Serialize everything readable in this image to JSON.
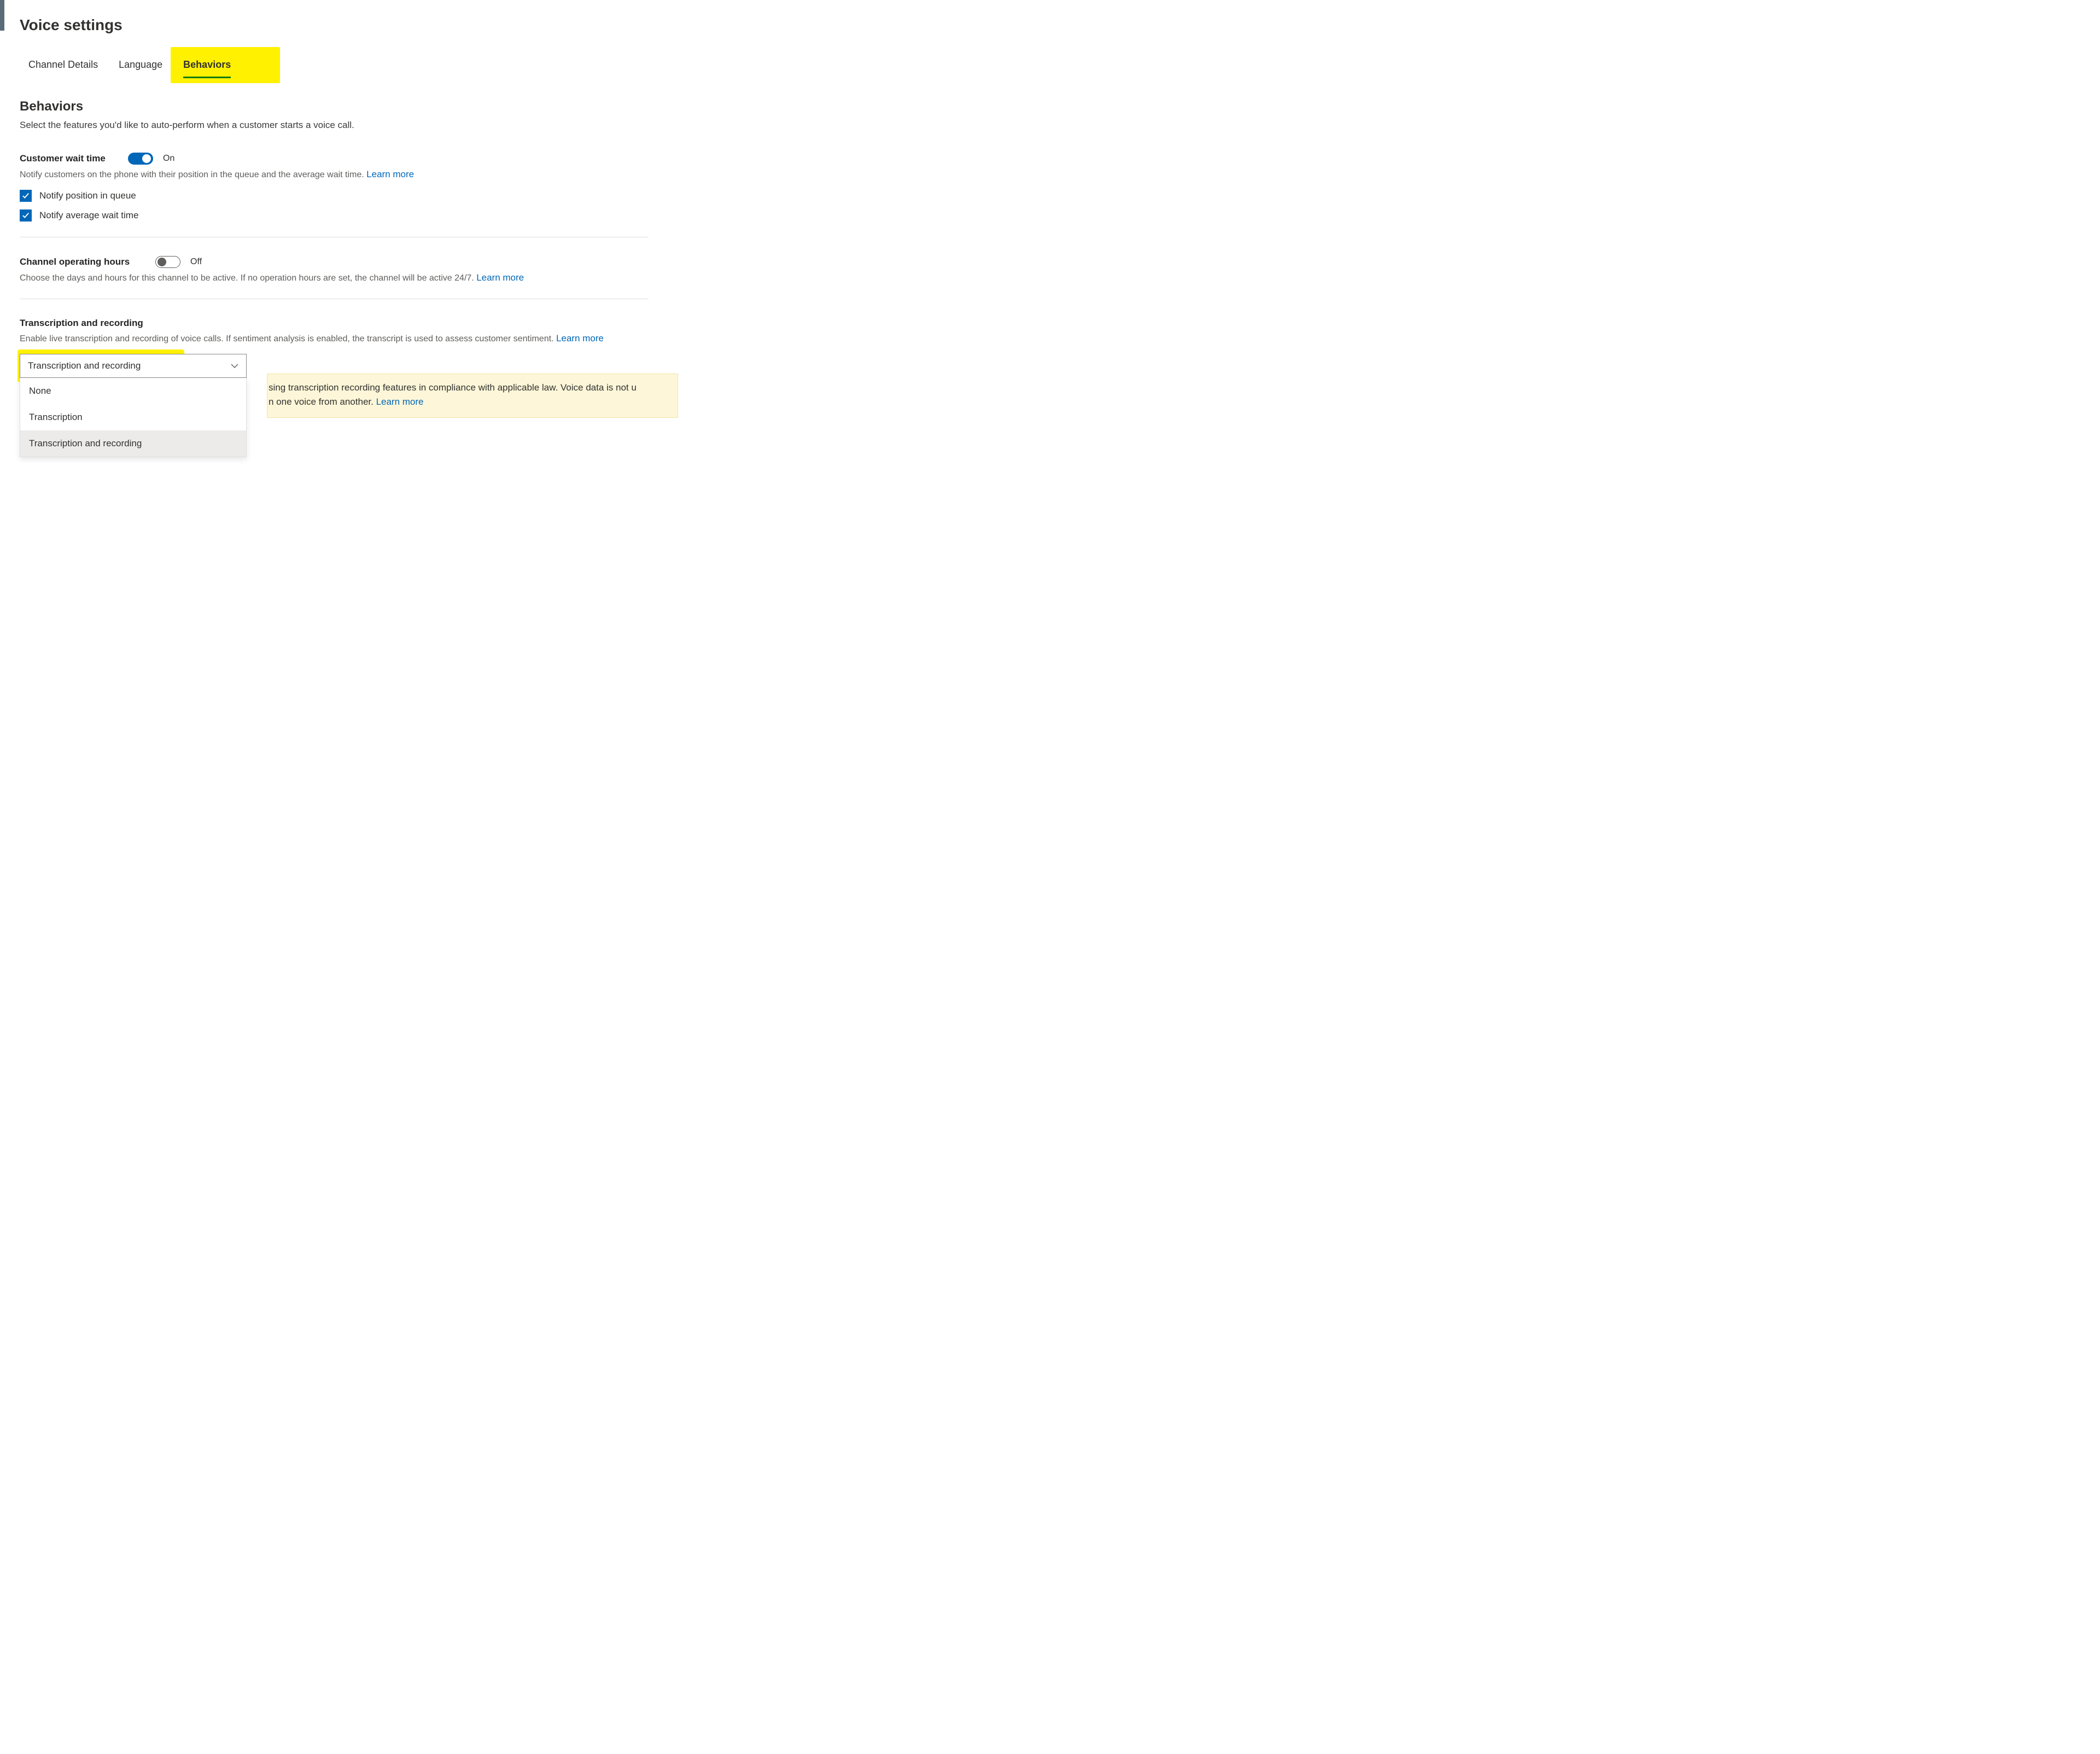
{
  "page": {
    "title": "Voice settings"
  },
  "tabs": {
    "channel_details": "Channel Details",
    "language": "Language",
    "behaviors": "Behaviors"
  },
  "section": {
    "heading": "Behaviors",
    "description": "Select the features you'd like to auto-perform when a customer starts a voice call."
  },
  "wait_time": {
    "label": "Customer wait time",
    "state": "On",
    "help": "Notify customers on the phone with their position in the queue and the average wait time.",
    "learn_more": "Learn more",
    "cb_position": "Notify position in queue",
    "cb_avg": "Notify average wait time"
  },
  "operating_hours": {
    "label": "Channel operating hours",
    "state": "Off",
    "help": "Choose the days and hours for this channel to be active. If no operation hours are set, the channel will be active 24/7.",
    "learn_more": "Learn more"
  },
  "transcription": {
    "label": "Transcription and recording",
    "help": "Enable live transcription and recording of voice calls. If sentiment analysis is enabled, the transcript is used to assess customer sentiment.",
    "learn_more": "Learn more",
    "selected": "Transcription and recording",
    "options": {
      "none": "None",
      "transcription": "Transcription",
      "both": "Transcription and recording"
    },
    "banner_line1": "sing transcription recording features in compliance with applicable law. Voice data is not u",
    "banner_line2": "n one voice from another. ",
    "banner_learn_more": "Learn more"
  }
}
